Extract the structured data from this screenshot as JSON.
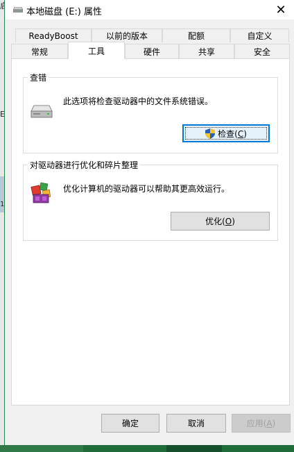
{
  "window": {
    "title": "本地磁盘 (E:) 属性",
    "close_glyph": "✕"
  },
  "tabs": {
    "row1": [
      "ReadyBoost",
      "以前的版本",
      "配额",
      "自定义"
    ],
    "row2": [
      "常规",
      "工具",
      "硬件",
      "共享",
      "安全"
    ],
    "active": "工具"
  },
  "error_check": {
    "group_title": "查错",
    "description": "此选项将检查驱动器中的文件系统错误。",
    "button_label": "检查",
    "button_key": "C"
  },
  "optimize": {
    "group_title": "对驱动器进行优化和碎片整理",
    "description": "优化计算机的驱动器可以帮助其更高效运行。",
    "button_label": "优化",
    "button_key": "O"
  },
  "footer": {
    "ok_label": "确定",
    "cancel_label": "取消",
    "apply_label": "应用",
    "apply_key": "A"
  },
  "background": {
    "fragment_1": "启",
    "fragment_2": "E",
    "fragment_3": "1"
  },
  "colors": {
    "focus_border": "#0078d7",
    "window_bg": "#f0f0f0",
    "panel_bg": "#ffffff"
  }
}
